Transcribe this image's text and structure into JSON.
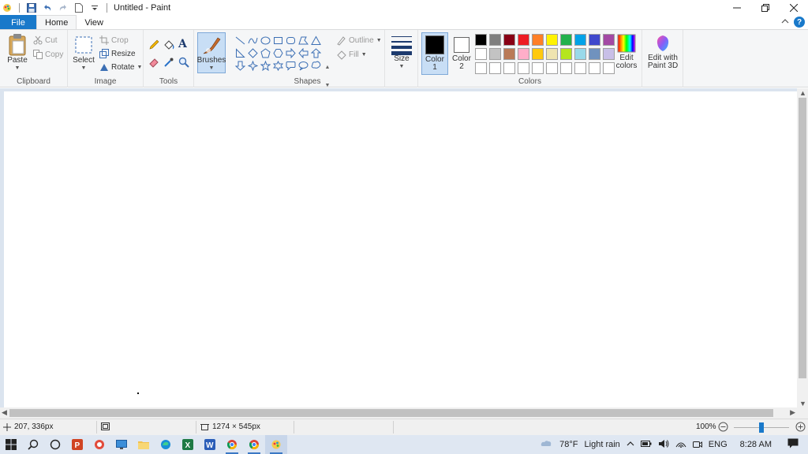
{
  "window": {
    "title": "Untitled - Paint",
    "qat_icons": [
      "paint-app-icon",
      "save-icon",
      "undo-icon",
      "redo-icon",
      "new-file-icon",
      "customize-qat-icon"
    ]
  },
  "tabs": {
    "file": "File",
    "home": "Home",
    "view": "View"
  },
  "ribbon": {
    "clipboard": {
      "label": "Clipboard",
      "paste": "Paste",
      "cut": "Cut",
      "copy": "Copy"
    },
    "image": {
      "label": "Image",
      "select": "Select",
      "crop": "Crop",
      "resize": "Resize",
      "rotate": "Rotate"
    },
    "tools": {
      "label": "Tools",
      "icons": [
        "pencil-icon",
        "fill-bucket-icon",
        "text-icon",
        "eraser-icon",
        "color-picker-icon",
        "magnifier-icon"
      ]
    },
    "brushes": {
      "label": "Brushes"
    },
    "shapes": {
      "label": "Shapes",
      "outline": "Outline",
      "fill": "Fill",
      "items": [
        "line",
        "curve",
        "oval",
        "rectangle",
        "rounded-rectangle",
        "polygon",
        "triangle",
        "right-triangle",
        "diamond",
        "pentagon",
        "hexagon",
        "right-arrow",
        "left-arrow",
        "up-arrow",
        "down-arrow",
        "four-point-star",
        "five-point-star",
        "six-point-star",
        "rounded-callout",
        "oval-callout",
        "cloud-callout"
      ]
    },
    "size": {
      "label": "Size"
    },
    "color1": {
      "label": "Color",
      "sub": "1",
      "value": "#000000"
    },
    "color2": {
      "label": "Color",
      "sub": "2",
      "value": "#ffffff"
    },
    "colors": {
      "label": "Colors",
      "edit": "Edit colors",
      "palette": [
        "#000000",
        "#7f7f7f",
        "#880015",
        "#ed1c24",
        "#ff7f27",
        "#fff200",
        "#22b14c",
        "#00a2e8",
        "#3f48cc",
        "#a349a4",
        "#ffffff",
        "#c3c3c3",
        "#b97a57",
        "#ffaec9",
        "#ffc90e",
        "#efe4b0",
        "#b5e61d",
        "#99d9ea",
        "#7092be",
        "#c8bfe7",
        "#ffffff",
        "#ffffff",
        "#ffffff",
        "#ffffff",
        "#ffffff",
        "#ffffff",
        "#ffffff",
        "#ffffff",
        "#ffffff",
        "#ffffff"
      ]
    },
    "paint3d": {
      "label": "Edit with Paint 3D"
    }
  },
  "status": {
    "cursor_pos": "207, 336px",
    "image_size": "1274 × 545px",
    "zoom": "100%",
    "zoom_level_percent": 100
  },
  "taskbar": {
    "apps": [
      "windows-start-icon",
      "search-icon",
      "task-view-icon",
      "powerpoint-icon",
      "media-player-icon",
      "desktop-icon",
      "file-explorer-icon",
      "edge-icon",
      "excel-icon",
      "word-icon",
      "chrome-icon",
      "chrome-icon",
      "paint-icon"
    ],
    "weather_temp": "78°F",
    "weather_text": "Light rain",
    "language": "ENG",
    "time": "8:28 AM"
  },
  "accent_color": "#1979ca"
}
